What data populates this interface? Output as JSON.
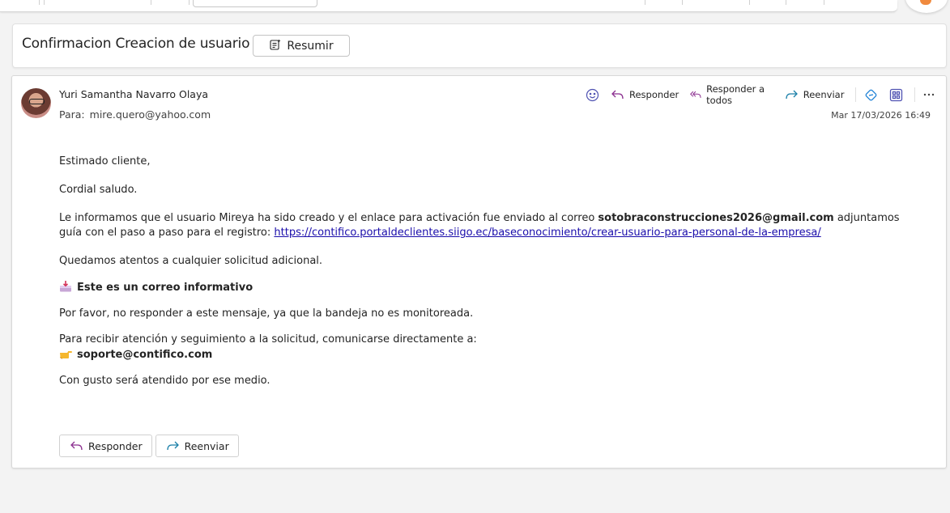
{
  "subject": {
    "title": "Confirmacion Creacion de usuario",
    "summarize_label": "Resumir"
  },
  "message": {
    "sender_name": "Yuri Samantha Navarro Olaya",
    "to_label": "Para:",
    "to_address": "mire.quero@yahoo.com",
    "date": "Mar 17/03/2026 16:49",
    "actions": {
      "reply": "Responder",
      "reply_all": "Responder a todos",
      "forward": "Reenviar"
    },
    "body": {
      "greeting": "Estimado cliente,",
      "salutation": "Cordial saludo.",
      "info_pre": "Le informamos que el usuario Mireya ha sido creado y el enlace para activación fue enviado al correo ",
      "info_email": "sotobraconstrucciones2026@gmail.com",
      "info_post": " adjuntamos guía con el paso a paso para el registro: ",
      "link": "https://contifico.portaldeclientes.siigo.ec/baseconocimiento/crear-usuario-para-personal-de-la-empresa/",
      "attentive": "Quedamos atentos a cualquier solicitud adicional.",
      "informative_heading": "Este es un correo informativo",
      "no_reply": "Por favor, no responder a este mensaje, ya que la bandeja no es monitoreada.",
      "contact_intro": "Para recibir atención y seguimiento a la solicitud, comunicarse directamente a:",
      "support_email": "soporte@contifico.com",
      "closing": "Con gusto será atendido por ese medio."
    },
    "footer": {
      "reply": "Responder",
      "forward": "Reenviar"
    }
  },
  "colors": {
    "reply_icon": "#8b2f8f",
    "forward_icon": "#1a7fa8",
    "accent": "#4f52b2",
    "link": "#1a0dab"
  }
}
